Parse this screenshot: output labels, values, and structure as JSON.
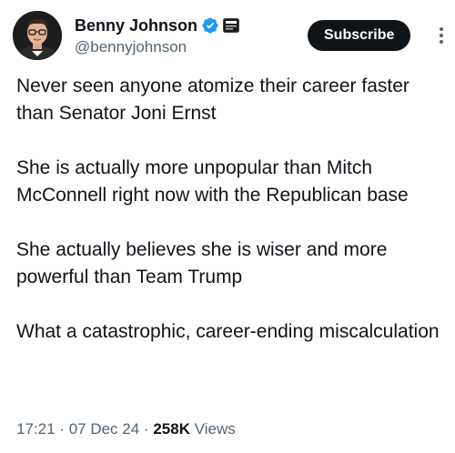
{
  "author": {
    "display_name": "Benny Johnson",
    "handle": "@bennyjohnson",
    "verified": true,
    "verified_color": "#1d9bf0"
  },
  "actions": {
    "subscribe_label": "Subscribe"
  },
  "tweet": {
    "paragraphs": [
      "Never seen anyone atomize their career faster than Senator Joni Ernst",
      "She is actually more unpopular than Mitch McConnell right now with the Republican base",
      "She actually believes she is wiser and more powerful than Team Trump",
      "What a catastrophic, career-ending miscalculation"
    ]
  },
  "meta": {
    "time": "17:21",
    "date": "07 Dec 24",
    "separator": "·",
    "views_count": "258K",
    "views_label": "Views"
  },
  "icons": {
    "verified": "verified-badge-icon",
    "affiliate": "affiliate-badge-icon",
    "more": "more-options-icon"
  }
}
